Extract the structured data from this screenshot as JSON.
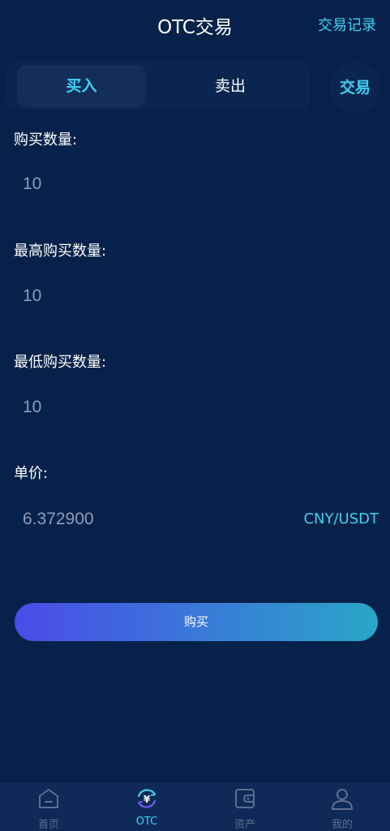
{
  "header": {
    "title": "OTC交易",
    "record_link": "交易记录"
  },
  "tabs": {
    "buy": "买入",
    "sell": "卖出"
  },
  "trade_button": "交易",
  "form": {
    "quantity": {
      "label": "购买数量:",
      "value": "10"
    },
    "max_quantity": {
      "label": "最高购买数量:",
      "value": "10"
    },
    "min_quantity": {
      "label": "最低购买数量:",
      "value": "10"
    },
    "price": {
      "label": "单价:",
      "value": "6.372900",
      "unit": "CNY/USDT"
    }
  },
  "submit_label": "购买",
  "bottom_nav": {
    "items": [
      {
        "label": "首页",
        "icon": "home-icon",
        "active": false
      },
      {
        "label": "OTC",
        "icon": "yuan-exchange-icon",
        "active": true
      },
      {
        "label": "资产",
        "icon": "wallet-icon",
        "active": false
      },
      {
        "label": "我的",
        "icon": "user-icon",
        "active": false
      }
    ]
  },
  "colors": {
    "background": "#07224a",
    "accent": "#3fd0f2",
    "nav_bg": "#0f2a58",
    "muted": "#5e6e8f"
  }
}
